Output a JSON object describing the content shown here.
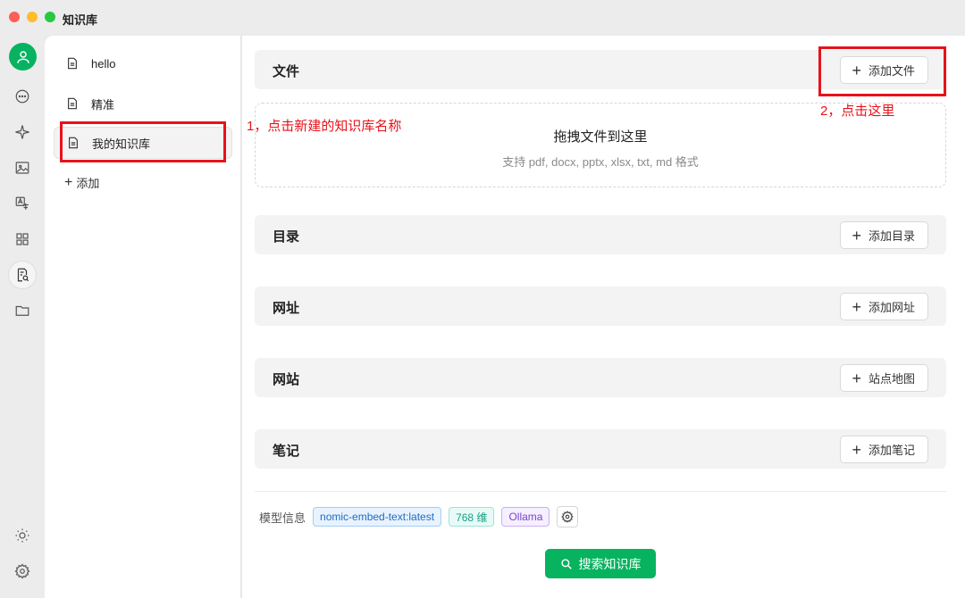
{
  "window": {
    "title": "知识库"
  },
  "knowledge_bases": [
    {
      "label": "hello"
    },
    {
      "label": "精准"
    },
    {
      "label": "我的知识库"
    }
  ],
  "add_kb_label": "添加",
  "sections": {
    "files": {
      "title": "文件",
      "button": "添加文件"
    },
    "dropzone": {
      "title": "拖拽文件到这里",
      "subtitle": "支持 pdf, docx, pptx, xlsx, txt, md 格式"
    },
    "directory": {
      "title": "目录",
      "button": "添加目录"
    },
    "url": {
      "title": "网址",
      "button": "添加网址"
    },
    "website": {
      "title": "网站",
      "button": "站点地图"
    },
    "notes": {
      "title": "笔记",
      "button": "添加笔记"
    }
  },
  "model_info": {
    "label": "模型信息",
    "embed_model": "nomic-embed-text:latest",
    "dimensions": "768 维",
    "provider": "Ollama"
  },
  "search_button": "搜索知识库",
  "annotations": {
    "step1": "1，点击新建的知识库名称",
    "step2": "2，点击这里"
  },
  "colors": {
    "accent_green": "#07b35f",
    "annotation_red": "#e8121a"
  },
  "icons": [
    "chat-icon",
    "sparkle-icon",
    "image-icon",
    "translate-icon",
    "apps-icon",
    "knowledge-search-icon",
    "folder-icon",
    "theme-sun-icon",
    "settings-gear-icon"
  ]
}
